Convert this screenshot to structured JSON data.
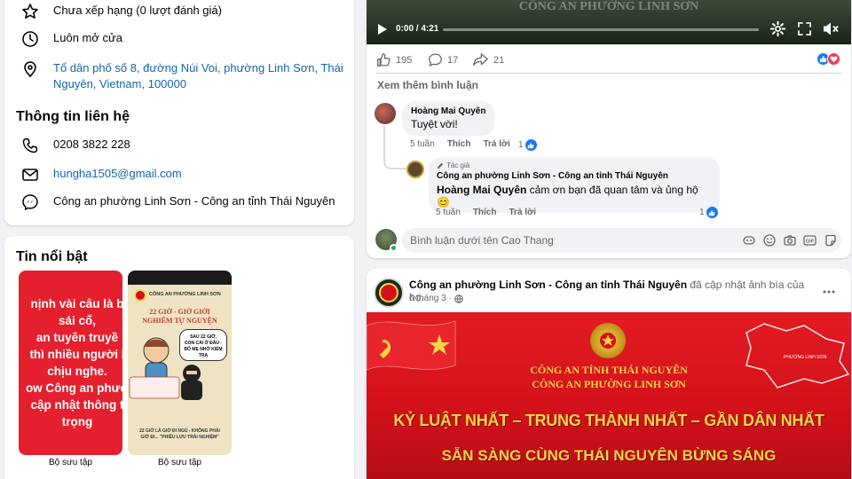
{
  "about": {
    "rating": "Chưa xếp hạng (0 lượt đánh giá)",
    "hours": "Luôn mở cửa",
    "address_line1": "Tổ dân phố số 8, đường Núi Voi, phường Linh Sơn, Thái",
    "address_line2": "Nguyên, Vietnam, 100000"
  },
  "contact": {
    "title": "Thông tin liên hệ",
    "phone": "0208 3822 228",
    "email": "hungha1505@gmail.com",
    "messenger": "Công an phường Linh Sơn - Công an tỉnh Thái Nguyên"
  },
  "featured": {
    "title": "Tin nổi bật",
    "stories": [
      {
        "caption": "Bộ sưu tập",
        "lines": [
          "nịnh vài câu là b",
          "sái cổ,",
          "an tuyên truyề",
          "thì nhiều người l",
          "chịu nghe.",
          "ow Công an phườ",
          "cập nhật thông t",
          "trọng"
        ]
      },
      {
        "caption": "Bộ sưu tập",
        "header": "CÔNG AN PHƯỜNG LINH SƠN",
        "headline1": "22 GIỜ - GIỜ GIỚI",
        "headline2": "NGHIÊM TỰ NGUYỆN",
        "bubble1": "SAU 22 GIỜ,",
        "bubble2": "CON CÁI Ở ĐÂU -",
        "bubble3": "BỐ MẸ NHỚ KIỂM TRA",
        "footer1": "22 GIỜ LÀ GIỜ ĐI NGỦ - KHÔNG PHẢI",
        "footer2": "GIỜ ĐI... \"PHIÊU LƯU TRẢI NGHIỆM\""
      }
    ]
  },
  "video_post": {
    "video_overlay_text": "CÔNG AN PHƯỜNG LINH SƠN",
    "time": "0:00 / 4:21",
    "progress_fraction": 0.0,
    "likes": "195",
    "comments": "17",
    "shares": "21",
    "see_more_comments": "Xem thêm bình luận",
    "comments_list": [
      {
        "author": "Hoàng Mai Quyên",
        "text": "Tuyệt vời!",
        "age": "5 tuần",
        "like_label": "Thích",
        "reply_label": "Trả lời",
        "reaction_count": "1"
      }
    ],
    "reply": {
      "badge": "Tác giả",
      "author": "Công an phường Linh Sơn - Công an tỉnh Thái Nguyên",
      "mention": "Hoàng Mai Quyên",
      "text": " cảm ơn bạn đã quan tâm và ủng hộ 😊",
      "age": "5 tuần",
      "like_label": "Thích",
      "reply_label": "Trả lời",
      "reaction_count": "1"
    },
    "comment_placeholder": "Bình luận dưới tên Cao Thang"
  },
  "cover_post": {
    "page_name": "Công an phường Linh Sơn - Công an tỉnh Thái Nguyên",
    "action": " đã cập nhật ảnh bìa của họ.",
    "date": "6 tháng 3 ·",
    "banner": {
      "line1": "CÔNG AN TỈNH THÁI NGUYÊN",
      "line2": "CÔNG AN PHƯỜNG LINH SƠN",
      "slogan1": "KỶ LUẬT NHẤT – TRUNG THÀNH NHẤT – GẦN DÂN NHẤT",
      "slogan2": "SẴN SÀNG CÙNG THÁI NGUYÊN BỪNG SÁNG",
      "map_label": "PHƯỜNG LINH SƠN"
    }
  },
  "colors": {
    "accent": "#1877f2",
    "link": "#1464b5",
    "banner_red": "#d4111a",
    "banner_gold": "#f7d447"
  }
}
